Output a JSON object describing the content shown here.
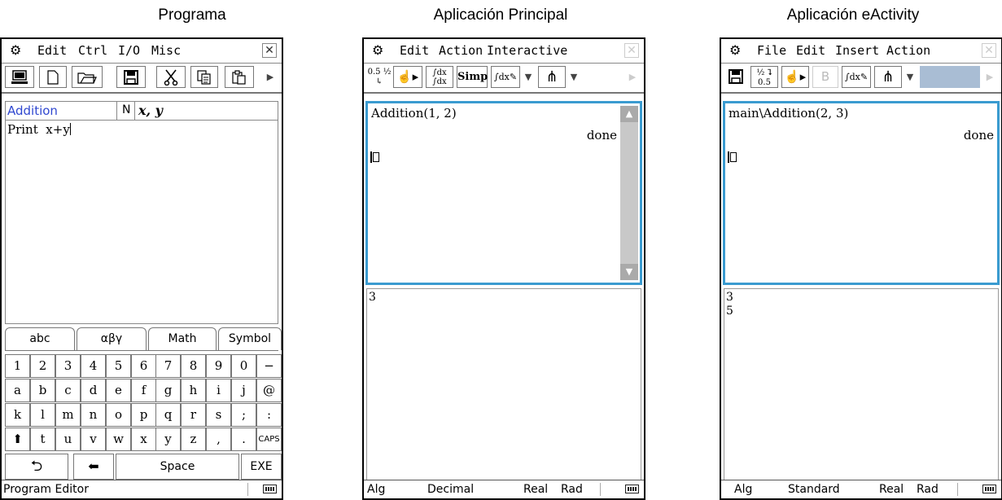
{
  "captions": {
    "program": "Programa",
    "main": "Aplicación Principal",
    "eactivity": "Aplicación eActivity"
  },
  "program_editor": {
    "menu": [
      "Edit",
      "Ctrl",
      "I/O",
      "Misc"
    ],
    "toolbar_icons": [
      "editor-icon",
      "new-file-icon",
      "open-folder-icon",
      "save-icon",
      "cut-icon",
      "copy-icon",
      "paste-icon",
      "more-arrow-icon"
    ],
    "program_name": "Addition",
    "param_type": "N",
    "params": "x, y",
    "code_line": "Print  x+y",
    "keyboard_tabs": [
      "abc",
      "αβγ",
      "Math",
      "Symbol"
    ],
    "keyboard_rows": [
      [
        "1",
        "2",
        "3",
        "4",
        "5",
        "6",
        "7",
        "8",
        "9",
        "0",
        "−"
      ],
      [
        "a",
        "b",
        "c",
        "d",
        "e",
        "f",
        "g",
        "h",
        "i",
        "j",
        "@"
      ],
      [
        "k",
        "l",
        "m",
        "n",
        "o",
        "p",
        "q",
        "r",
        "s",
        ";",
        ":"
      ],
      [
        "⬆",
        "t",
        "u",
        "v",
        "w",
        "x",
        "y",
        "z",
        ",",
        ".",
        "CAPS"
      ]
    ],
    "bottom_keys": {
      "back": "⮌",
      "backspace": "⬅",
      "space": "Space",
      "exe": "EXE"
    },
    "status": "Program Editor"
  },
  "main_app": {
    "menu": [
      "Edit",
      "Action",
      "Interactive"
    ],
    "toolbar": {
      "decimal": "0.5 ½",
      "simp": "Simp"
    },
    "input_line": "Addition(1, 2)",
    "result": "done",
    "output": "3",
    "status": [
      "Alg",
      "Decimal",
      "Real",
      "Rad"
    ]
  },
  "eactivity_app": {
    "menu": [
      "File",
      "Edit",
      "Insert",
      "Action"
    ],
    "input_line": "main\\Addition(2, 3)",
    "result": "done",
    "output": [
      "3",
      "5"
    ],
    "status": [
      "Alg",
      "Standard",
      "Real",
      "Rad"
    ]
  }
}
